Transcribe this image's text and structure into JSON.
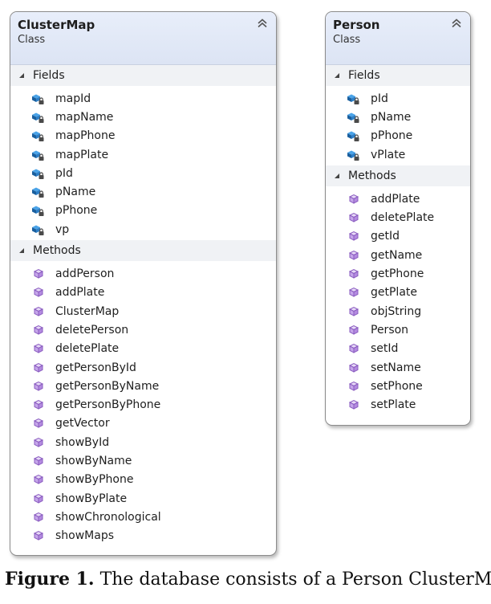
{
  "cluster_map": {
    "title": "ClusterMap",
    "stereotype": "Class",
    "fields_label": "Fields",
    "methods_label": "Methods",
    "fields": [
      "mapId",
      "mapName",
      "mapPhone",
      "mapPlate",
      "pId",
      "pName",
      "pPhone",
      "vp"
    ],
    "methods": [
      "addPerson",
      "addPlate",
      "ClusterMap",
      "deletePerson",
      "deletePlate",
      "getPersonById",
      "getPersonByName",
      "getPersonByPhone",
      "getVector",
      "showById",
      "showByName",
      "showByPhone",
      "showByPlate",
      "showChronological",
      "showMaps"
    ]
  },
  "person": {
    "title": "Person",
    "stereotype": "Class",
    "fields_label": "Fields",
    "methods_label": "Methods",
    "fields": [
      "pId",
      "pName",
      "pPhone",
      "vPlate"
    ],
    "methods": [
      "addPlate",
      "deletePlate",
      "getId",
      "getName",
      "getPhone",
      "getPlate",
      "objString",
      "Person",
      "setId",
      "setName",
      "setPhone",
      "setPlate"
    ]
  },
  "caption": {
    "label": "Figure 1.",
    "text": "The database consists of a Person ClusterMap"
  },
  "colors": {
    "header_bg": "#dce4f4",
    "field_icon": "#1a6fb5",
    "method_icon": "#8a5cc0",
    "lock": "#555555"
  },
  "icons": {
    "collapse": "double-chevron-up-icon",
    "section_toggle": "collapse-triangle-icon",
    "field": "private-field-icon",
    "method": "method-cube-icon"
  }
}
